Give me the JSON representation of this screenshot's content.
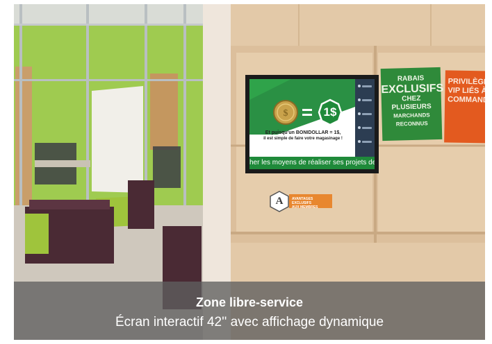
{
  "caption": {
    "title": "Zone libre-service",
    "subtitle": "Écran interactif 42'' avec affichage dynamique"
  },
  "screen": {
    "equation_right": "1$",
    "tagline_line1": "Et puisqu'un BONIDOLLAR = 1$,",
    "tagline_line2": "il est simple de faire votre magasinage !",
    "ticker": "her les moyens de réaliser ses projets de vie"
  },
  "signs": {
    "green_line1": "RABAIS",
    "green_line2": "EXCLUSIFS",
    "green_line3": "CHEZ PLUSIEURS",
    "green_line4": "MARCHANDS RECONNUS",
    "orange_line1": "PRIVILÈGES",
    "orange_line2": "VIP LIÉS À NOS",
    "orange_line3": "COMMANDITES"
  },
  "badge": {
    "letter": "A",
    "label_line1": "AVANTAGES EXCLUSIFS",
    "label_line2": "AUX MEMBRES"
  },
  "colors": {
    "wall_green": "#93c53a",
    "wood_panel": "#e3c9a8",
    "screen_green": "#1f8a3a",
    "sign_green": "#2f8a3a",
    "sign_orange": "#e35a1f",
    "caption_bar": "#5f5f5f",
    "couch_purple": "#4a2a34",
    "couch_lime": "#9fc43c"
  }
}
